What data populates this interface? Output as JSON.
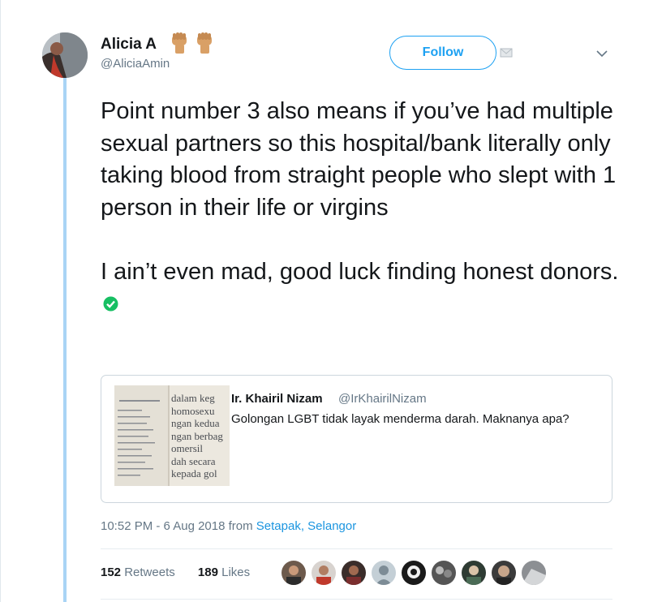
{
  "user": {
    "display_name": "Alicia A",
    "handle": "@AliciaAmin",
    "name_emoji": [
      "raised-fist-emoji",
      "raised-fist-emoji"
    ]
  },
  "header": {
    "follow_label": "Follow"
  },
  "tweet": {
    "text_paragraph_1": "Point number 3 also means if you’ve had multiple sexual partners so this hospital/bank literally only taking blood from straight people who slept with 1 person in their life or virgins",
    "text_paragraph_2": "I ain’t even mad, good luck finding honest donors.",
    "trailing_icon": "check-mark-icon"
  },
  "quote": {
    "name": "Ir. Khairil Nizam",
    "handle": "@IrKhairilNizam",
    "text": "Golongan LGBT tidak layak menderma darah. Maknanya apa?",
    "media_text_lines": [
      "dalam keg",
      "homosexu",
      "ngan kedua",
      "ngan berbag",
      "omersil",
      "dah secara",
      "kepada gol"
    ]
  },
  "meta": {
    "time": "10:52 PM - 6 Aug 2018",
    "from_label": "from",
    "location": "Setapak, Selangor"
  },
  "stats": {
    "retweets_count": "152",
    "retweets_label": "Retweets",
    "likes_count": "189",
    "likes_label": "Likes"
  },
  "colors": {
    "accent": "#1da1f2",
    "link": "#1b95e0",
    "muted": "#657786",
    "thread_line": "#a9d4f5",
    "check": "#17bf63"
  }
}
